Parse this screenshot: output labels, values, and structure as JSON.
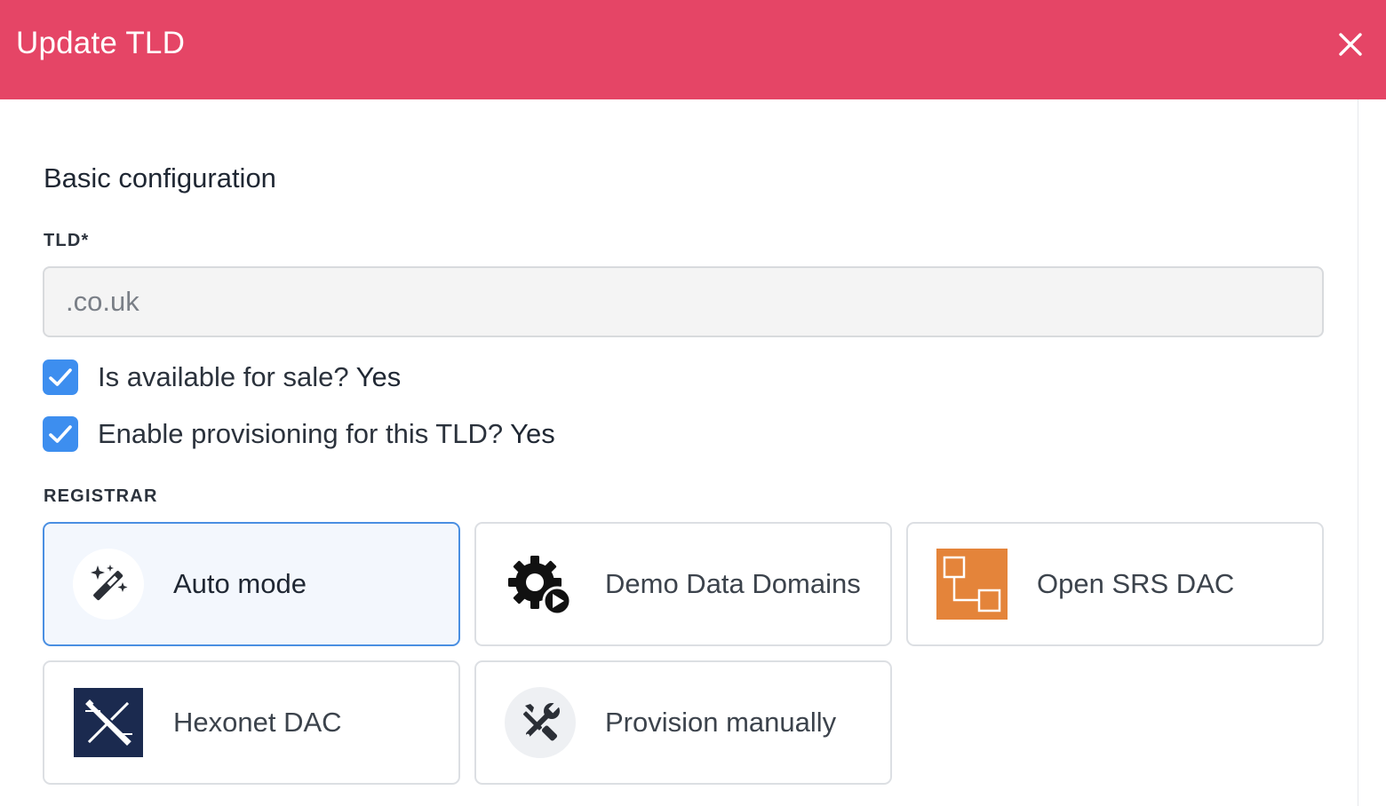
{
  "modal": {
    "title": "Update TLD",
    "close_icon": "close-icon",
    "header_color": "#e54566"
  },
  "basic": {
    "section_title": "Basic configuration",
    "tld_label": "TLD*",
    "tld_value": ".co.uk",
    "available_label": "Is available for sale?",
    "available_value": "Yes",
    "available_checked": true,
    "provisioning_label": "Enable provisioning for this TLD?",
    "provisioning_value": "Yes",
    "provisioning_checked": true
  },
  "registrar": {
    "label": "REGISTRAR",
    "selected": "Auto mode",
    "options": [
      {
        "label": "Auto mode",
        "icon": "magic-wand-icon"
      },
      {
        "label": "Demo Data Domains",
        "icon": "gear-play-icon"
      },
      {
        "label": "Open SRS DAC",
        "icon": "opensrs-logo-icon"
      },
      {
        "label": "Hexonet DAC",
        "icon": "hexonet-logo-icon"
      },
      {
        "label": "Provision manually",
        "icon": "tools-icon"
      }
    ]
  },
  "colors": {
    "accent": "#3d8eef",
    "selected_border": "#4a8fe2",
    "opensrs_orange": "#e4843a",
    "hexonet_navy": "#1b2a4f"
  }
}
